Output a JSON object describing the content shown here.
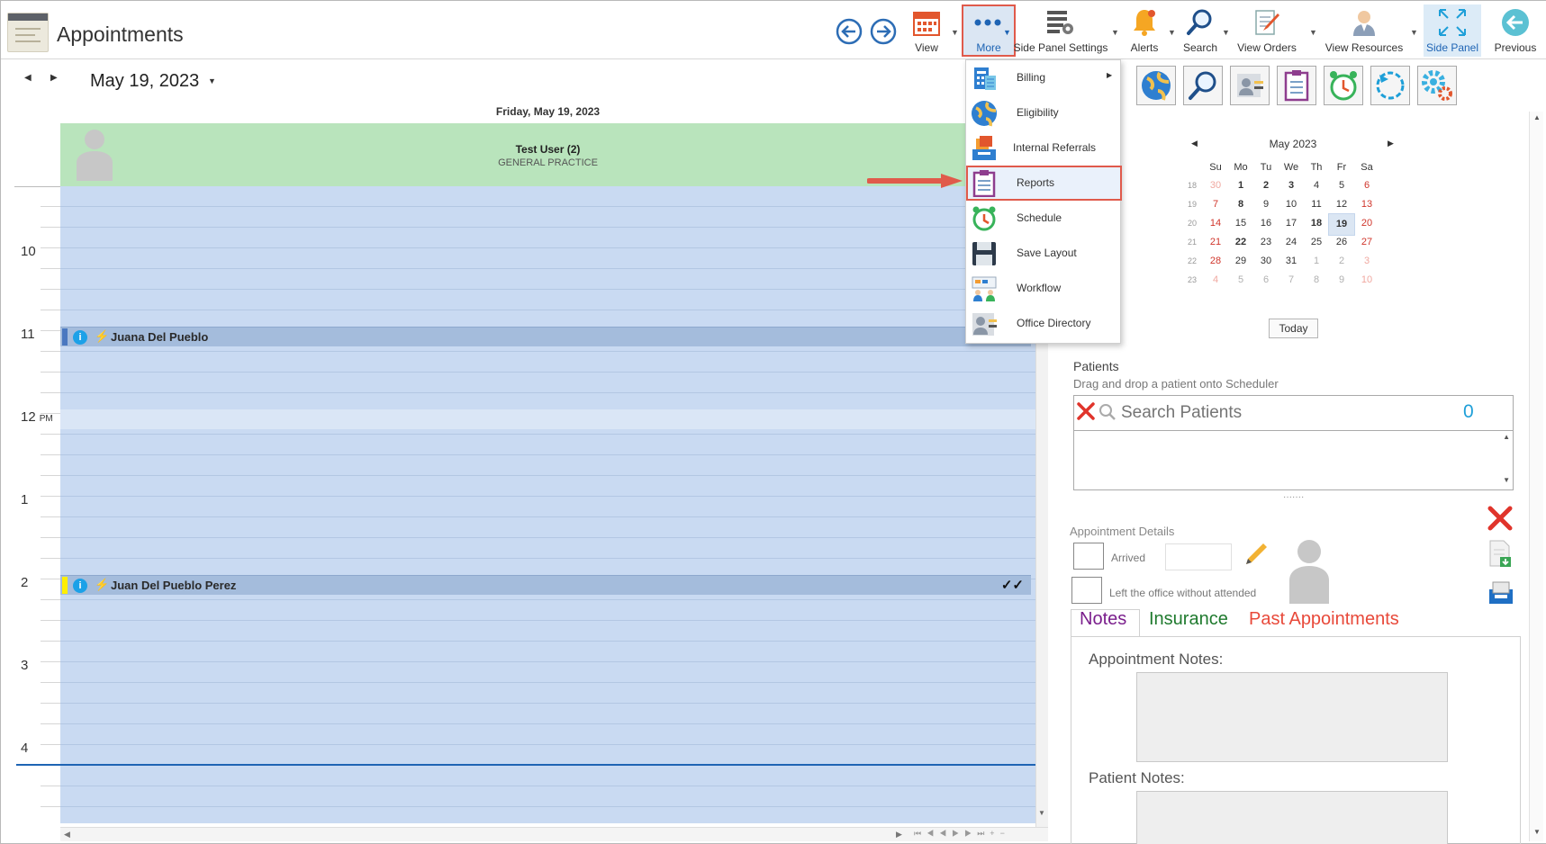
{
  "header": {
    "title": "Appointments"
  },
  "toolbar": {
    "view_label": "View",
    "more_label": "More",
    "side_panel_settings_label": "Side Panel Settings",
    "alerts_label": "Alerts",
    "search_label": "Search",
    "view_orders_label": "View Orders",
    "view_resources_label": "View Resources",
    "side_panel_label": "Side Panel",
    "previous_label": "Previous"
  },
  "scheduler": {
    "date_title": "May 19, 2023",
    "day_header": "Friday, May 19, 2023",
    "resource_name": "Test User (2)",
    "resource_subtitle": "GENERAL PRACTICE",
    "hours": [
      {
        "label": "10",
        "suffix": ""
      },
      {
        "label": "11",
        "suffix": ""
      },
      {
        "label": "12",
        "suffix": "PM"
      },
      {
        "label": "1",
        "suffix": ""
      },
      {
        "label": "2",
        "suffix": ""
      },
      {
        "label": "3",
        "suffix": ""
      },
      {
        "label": "4",
        "suffix": ""
      }
    ],
    "appointments": [
      {
        "name": "Juana Del Pueblo",
        "status_color": "#4a78c0",
        "checks": ""
      },
      {
        "name": "Juan Del Pueblo Perez",
        "status_color": "#ffee00",
        "checks": "✓✓"
      }
    ],
    "info_glyph": "i"
  },
  "more_menu": {
    "items": [
      {
        "label": "Billing",
        "icon": "billing-icon",
        "has_submenu": true
      },
      {
        "label": "Eligibility",
        "icon": "globe-icon"
      },
      {
        "label": "Internal Referrals",
        "icon": "referrals-icon"
      },
      {
        "label": "Reports",
        "icon": "reports-icon",
        "highlighted": true
      },
      {
        "label": "Schedule",
        "icon": "clock-icon"
      },
      {
        "label": "Save Layout",
        "icon": "floppy-icon"
      },
      {
        "label": "Workflow",
        "icon": "workflow-icon"
      },
      {
        "label": "Office Directory",
        "icon": "directory-icon"
      }
    ]
  },
  "calendar": {
    "month_title": "May 2023",
    "weekdays": [
      "Su",
      "Mo",
      "Tu",
      "We",
      "Th",
      "Fr",
      "Sa"
    ],
    "weeks": [
      {
        "wk": "18",
        "days": [
          "30",
          "1",
          "2",
          "3",
          "4",
          "5",
          "6"
        ]
      },
      {
        "wk": "19",
        "days": [
          "7",
          "8",
          "9",
          "10",
          "11",
          "12",
          "13"
        ]
      },
      {
        "wk": "20",
        "days": [
          "14",
          "15",
          "16",
          "17",
          "18",
          "19",
          "20"
        ]
      },
      {
        "wk": "21",
        "days": [
          "21",
          "22",
          "23",
          "24",
          "25",
          "26",
          "27"
        ]
      },
      {
        "wk": "22",
        "days": [
          "28",
          "29",
          "30",
          "31",
          "1",
          "2",
          "3"
        ]
      },
      {
        "wk": "23",
        "days": [
          "4",
          "5",
          "6",
          "7",
          "8",
          "9",
          "10"
        ]
      }
    ],
    "selected_day": "19",
    "today_label": "Today"
  },
  "patients": {
    "title": "Patients",
    "hint": "Drag and drop a patient onto Scheduler",
    "search_placeholder": "Search Patients",
    "count": "0"
  },
  "appointment_details": {
    "title": "Appointment Details",
    "arrived_label": "Arrived",
    "left_label": "Left the office without attended",
    "tabs": [
      {
        "label": "Notes",
        "color": "#7a1e8c"
      },
      {
        "label": "Insurance",
        "color": "#1f7a2e"
      },
      {
        "label": "Past Appointments",
        "color": "#e8493a"
      }
    ],
    "appointment_notes_label": "Appointment Notes:",
    "patient_notes_label": "Patient Notes:"
  },
  "colors": {
    "accent": "#1e64b4",
    "highlight": "#e05a4b",
    "grid": "#c9daf2",
    "resource_header": "#b9e4bc"
  }
}
